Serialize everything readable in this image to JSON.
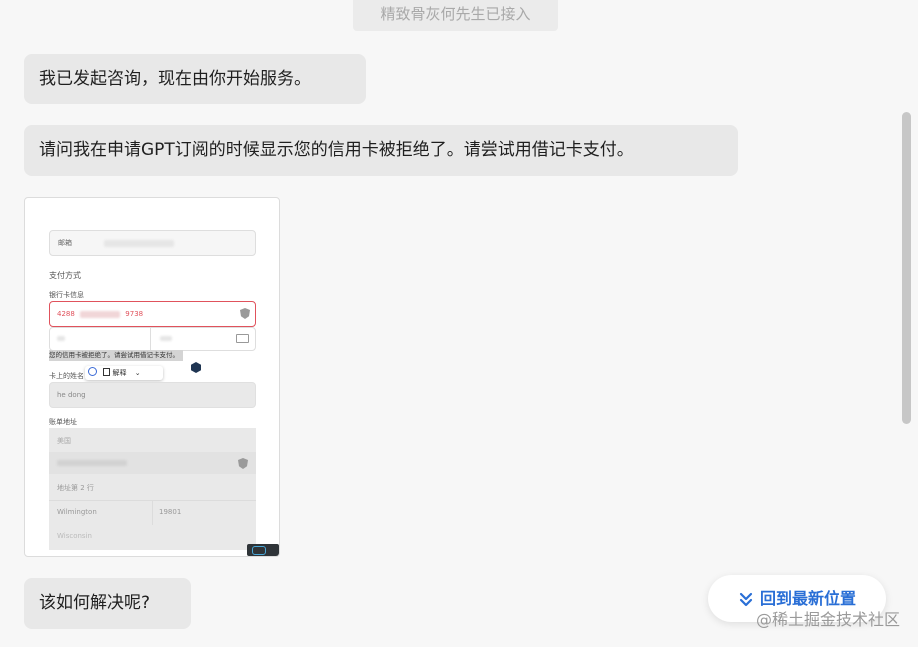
{
  "system_note": "精致骨灰何先生已接入",
  "messages": [
    {
      "text": "我已发起咨询，现在由你开始服务。"
    },
    {
      "text": "请问我在申请GPT订阅的时候显示您的信用卡被拒绝了。请尝试用借记卡支付。"
    },
    {
      "text": "该如何解决呢?"
    }
  ],
  "screenshot": {
    "email_label": "邮箱",
    "payment_method_label": "支付方式",
    "bank_card_label": "银行卡信息",
    "card_number_prefix": "4288",
    "card_number_suffix": "9738",
    "error_text": "您的信用卡被拒绝了。请尝试用借记卡支付。",
    "toolbar_label": "解释",
    "cardholder_label": "卡上的姓名",
    "cardholder_value": "he dong",
    "billing_label": "账单地址",
    "country_value": "美国",
    "address2_placeholder": "地址第 2 行",
    "city_value": "Wilmington",
    "zip_value": "19801",
    "state_value": "Wisconsin"
  },
  "jump_to_latest": "回到最新位置",
  "watermark": "@稀土掘金技术社区",
  "colors": {
    "accent": "#2a6fd6",
    "bubble": "#e8e8e8",
    "error": "#e0525c"
  }
}
